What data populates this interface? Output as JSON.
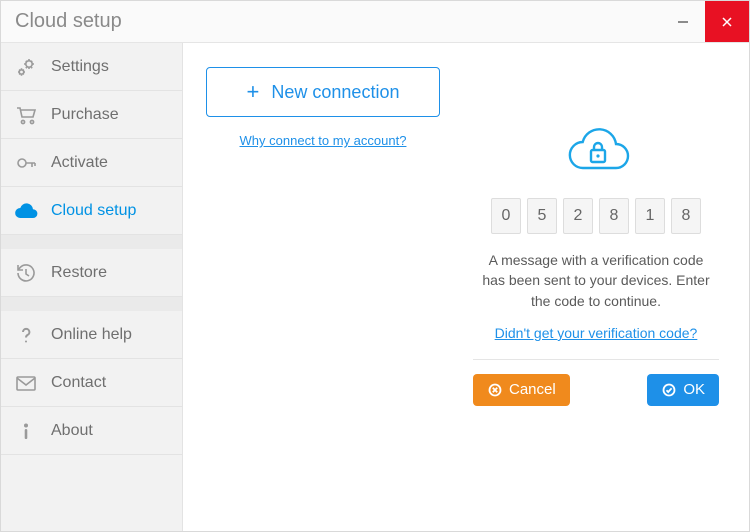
{
  "window": {
    "title": "Cloud setup"
  },
  "sidebar": {
    "items": [
      {
        "label": "Settings"
      },
      {
        "label": "Purchase"
      },
      {
        "label": "Activate"
      },
      {
        "label": "Cloud setup"
      },
      {
        "label": "Restore"
      },
      {
        "label": "Online help"
      },
      {
        "label": "Contact"
      },
      {
        "label": "About"
      }
    ]
  },
  "main": {
    "new_connection_label": "New connection",
    "why_link": "Why connect to my account?"
  },
  "verify": {
    "code": [
      "0",
      "5",
      "2",
      "8",
      "1",
      "8"
    ],
    "message": "A message with a verification code has been sent to your devices. Enter the code to continue.",
    "resend_link": "Didn't get your verification code?",
    "cancel_label": "Cancel",
    "ok_label": "OK"
  }
}
